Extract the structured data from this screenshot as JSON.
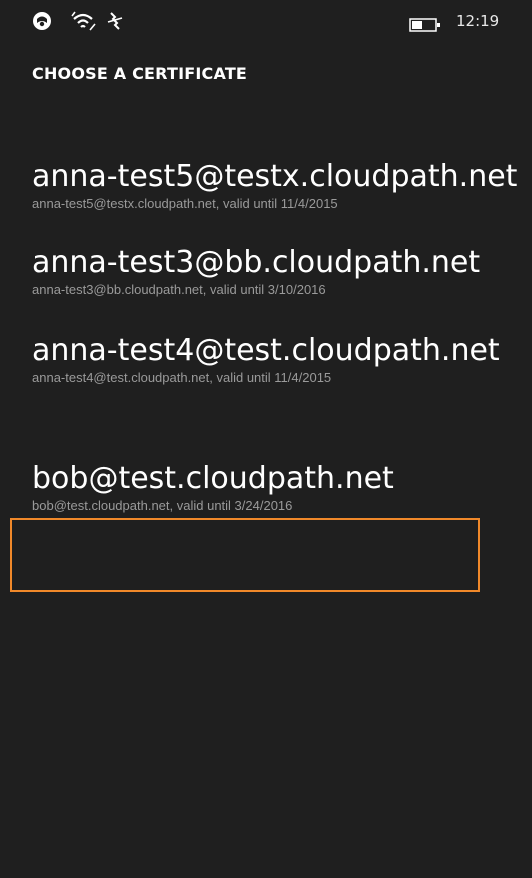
{
  "status_bar": {
    "time": "12:19",
    "icons": [
      "notification-icon",
      "wifi-icon",
      "data-icon",
      "battery-icon"
    ]
  },
  "page": {
    "title": "CHOOSE A CERTIFICATE"
  },
  "certificates": [
    {
      "name": "anna-test5@testx.cloudpath.net",
      "detail": "anna-test5@testx.cloudpath.net, valid until 11/4/2015"
    },
    {
      "name": "anna-test3@bb.cloudpath.net",
      "detail": "anna-test3@bb.cloudpath.net, valid until 3/10/2016"
    },
    {
      "name": "anna-test4@test.cloudpath.net",
      "detail": "anna-test4@test.cloudpath.net, valid until 11/4/2015"
    },
    {
      "name": "bob@test.cloudpath.net",
      "detail": "bob@test.cloudpath.net, valid until 3/24/2016",
      "selected": true
    }
  ],
  "colors": {
    "background": "#1f1f1f",
    "accent": "#f0892a",
    "secondary_text": "#9a9a9a"
  }
}
